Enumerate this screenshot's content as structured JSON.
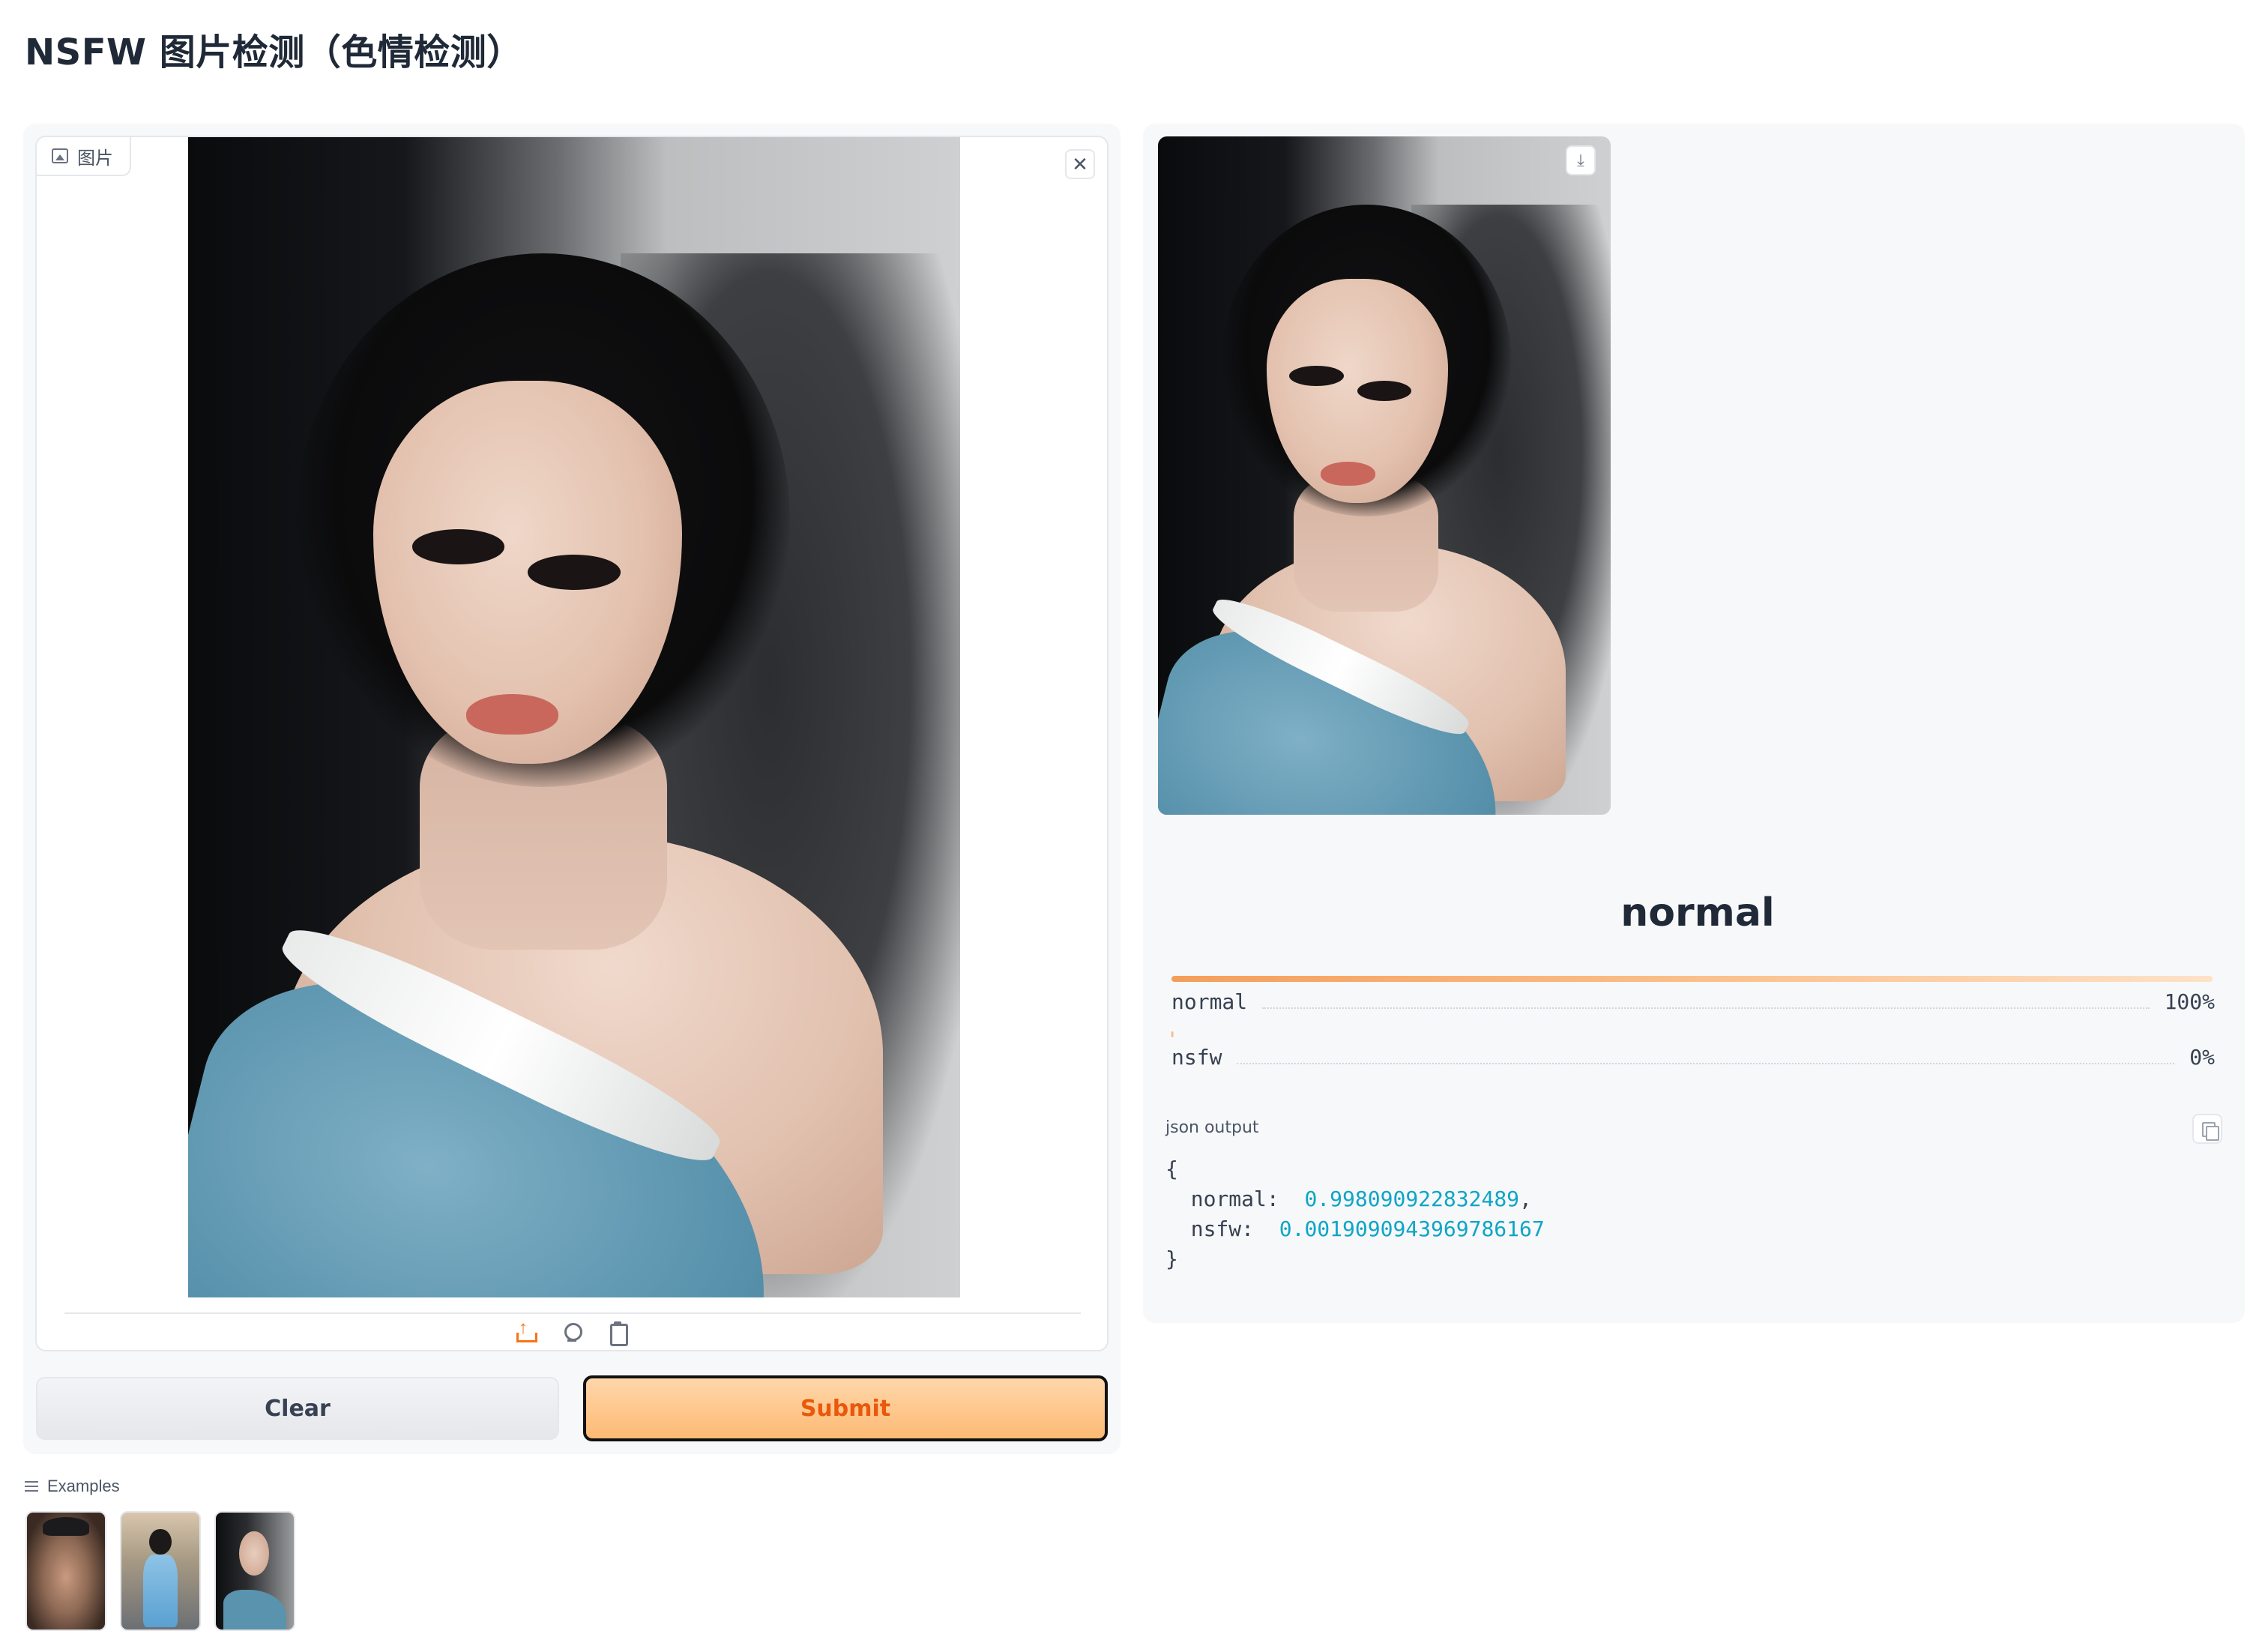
{
  "page": {
    "title": "NSFW 图片检测（色情检测）"
  },
  "input": {
    "label": "图片",
    "image_icon": "image-icon",
    "clear_icon": "close-icon",
    "sources": [
      {
        "name": "upload",
        "icon": "upload-icon"
      },
      {
        "name": "webcam",
        "icon": "webcam-icon"
      },
      {
        "name": "clipboard",
        "icon": "clipboard-icon"
      }
    ]
  },
  "buttons": {
    "clear_label": "Clear",
    "submit_label": "Submit"
  },
  "examples": {
    "label": "Examples",
    "count": 3
  },
  "output": {
    "download_icon": "download-icon",
    "top_label": "normal",
    "confidences": [
      {
        "label": "normal",
        "percent": "100%",
        "value": 0.998090922832489
      },
      {
        "label": "nsfw",
        "percent": "0%",
        "value": 0.0019090943969786167
      }
    ],
    "json_label": "json output",
    "json": {
      "open": "{",
      "k1": "normal:",
      "v1": "0.998090922832489",
      "k2": "nsfw:",
      "v2": "0.0019090943969786167",
      "close": "}"
    }
  },
  "colors": {
    "accent": "#f97316",
    "submit_text": "#ea580c",
    "json_value": "#0ea5c6"
  }
}
